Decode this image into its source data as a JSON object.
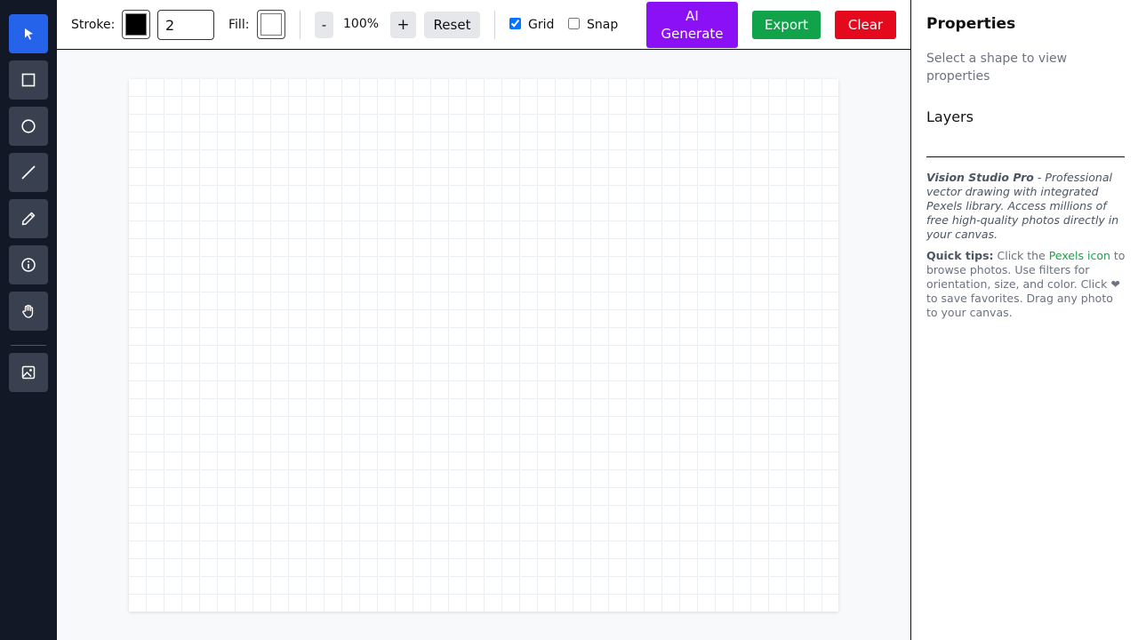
{
  "tools": [
    {
      "name": "select",
      "icon": "cursor-arrow-icon",
      "active": true
    },
    {
      "name": "rectangle",
      "icon": "rectangle-icon"
    },
    {
      "name": "circle",
      "icon": "circle-icon"
    },
    {
      "name": "line",
      "icon": "line-icon"
    },
    {
      "name": "pencil",
      "icon": "pencil-icon"
    },
    {
      "name": "info",
      "icon": "info-icon"
    },
    {
      "name": "pan",
      "icon": "hand-icon"
    },
    {
      "name": "pexels",
      "icon": "image-icon"
    }
  ],
  "toolbar": {
    "stroke_label": "Stroke:",
    "stroke_color": "#000000",
    "stroke_width": "2",
    "fill_label": "Fill:",
    "fill_color": "#ffffff",
    "zoom_out": "-",
    "zoom_value": "100%",
    "zoom_in": "+",
    "reset": "Reset",
    "grid_label": "Grid",
    "grid_checked": true,
    "snap_label": "Snap",
    "snap_checked": false,
    "ai_generate": "AI Generate",
    "export": "Export",
    "clear": "Clear"
  },
  "colors": {
    "ai_generate": "#8b10f5",
    "export": "#10a34a",
    "clear": "#e5091e",
    "active_tool": "#2563eb"
  },
  "panel": {
    "title": "Properties",
    "hint": "Select a shape to view properties",
    "layers_title": "Layers",
    "desc_brand": "Vision Studio Pro",
    "desc_text": " - Professional vector drawing with integrated Pexels library. Access millions of free high-quality photos directly in your canvas.",
    "tips_label": "Quick tips:",
    "tips_pre": " Click the ",
    "tips_link": "Pexels icon",
    "tips_post": " to browse photos. Use filters for orientation, size, and color. Click ❤ to save favorites. Drag any photo to your canvas."
  }
}
